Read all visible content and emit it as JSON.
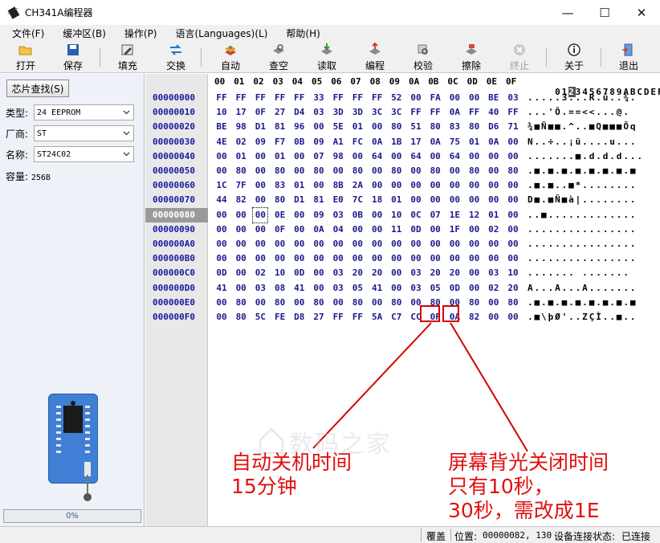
{
  "window": {
    "title": "CH341A编程器",
    "minimize": "—",
    "maximize": "☐",
    "close": "✕"
  },
  "menu": [
    "文件(F)",
    "缓冲区(B)",
    "操作(P)",
    "语言(Languages)(L)",
    "帮助(H)"
  ],
  "toolbar": {
    "open": "打开",
    "save": "保存",
    "fill": "填充",
    "swap": "交换",
    "auto": "自动",
    "blank": "查空",
    "read": "读取",
    "program": "编程",
    "verify": "校验",
    "erase": "擦除",
    "stop": "终止",
    "about": "关于",
    "exit": "退出"
  },
  "left": {
    "find_button": "芯片查找(S)",
    "type_label": "类型:",
    "type_value": "24 EEPROM",
    "maker_label": "厂商:",
    "maker_value": "ST",
    "name_label": "名称:",
    "name_value": "ST24C02",
    "capacity_label": "容量:",
    "capacity_value": "256B",
    "progress": "0%"
  },
  "hex": {
    "columns": [
      "00",
      "01",
      "02",
      "03",
      "04",
      "05",
      "06",
      "07",
      "08",
      "09",
      "0A",
      "0B",
      "0C",
      "0D",
      "0E",
      "0F"
    ],
    "ascii_header": "0123456789ABCDEF",
    "rows": [
      {
        "addr": "00000000",
        "bytes": [
          "FF",
          "FF",
          "FF",
          "FF",
          "FF",
          "33",
          "FF",
          "FF",
          "FF",
          "52",
          "00",
          "FA",
          "00",
          "00",
          "BE",
          "03"
        ],
        "ascii": ".....3...R.ú..¾."
      },
      {
        "addr": "00000010",
        "bytes": [
          "10",
          "17",
          "0F",
          "27",
          "D4",
          "03",
          "3D",
          "3D",
          "3C",
          "3C",
          "FF",
          "FF",
          "0A",
          "FF",
          "40",
          "FF"
        ],
        "ascii": "...'Ô.==<<...@."
      },
      {
        "addr": "00000020",
        "bytes": [
          "BE",
          "98",
          "D1",
          "81",
          "96",
          "00",
          "5E",
          "01",
          "00",
          "80",
          "51",
          "80",
          "83",
          "80",
          "D6",
          "71"
        ],
        "ascii": "¾■Ñ■■.^..■Q■■■Öq"
      },
      {
        "addr": "00000030",
        "bytes": [
          "4E",
          "02",
          "09",
          "F7",
          "0B",
          "09",
          "A1",
          "FC",
          "0A",
          "1B",
          "17",
          "0A",
          "75",
          "01",
          "0A",
          "00"
        ],
        "ascii": "N..÷..¡ü....u..."
      },
      {
        "addr": "00000040",
        "bytes": [
          "00",
          "01",
          "00",
          "01",
          "00",
          "07",
          "98",
          "00",
          "64",
          "00",
          "64",
          "00",
          "64",
          "00",
          "00",
          "00"
        ],
        "ascii": ".......■.d.d.d..."
      },
      {
        "addr": "00000050",
        "bytes": [
          "00",
          "80",
          "00",
          "80",
          "00",
          "80",
          "00",
          "80",
          "00",
          "80",
          "00",
          "80",
          "00",
          "80",
          "00",
          "80"
        ],
        "ascii": ".■.■.■.■.■.■.■.■"
      },
      {
        "addr": "00000060",
        "bytes": [
          "1C",
          "7F",
          "00",
          "83",
          "01",
          "00",
          "8B",
          "2A",
          "00",
          "00",
          "00",
          "00",
          "00",
          "00",
          "00",
          "00"
        ],
        "ascii": ".■.■..■*........"
      },
      {
        "addr": "00000070",
        "bytes": [
          "44",
          "82",
          "00",
          "80",
          "D1",
          "81",
          "E0",
          "7C",
          "18",
          "01",
          "00",
          "00",
          "00",
          "00",
          "00",
          "00"
        ],
        "ascii": "D■.■Ñ■à|........"
      },
      {
        "addr": "00000080",
        "bytes": [
          "00",
          "00",
          "00",
          "0E",
          "00",
          "09",
          "03",
          "0B",
          "00",
          "10",
          "0C",
          "07",
          "1E",
          "12",
          "01",
          "00"
        ],
        "ascii": "..■............."
      },
      {
        "addr": "00000090",
        "bytes": [
          "00",
          "00",
          "00",
          "0F",
          "00",
          "0A",
          "04",
          "00",
          "00",
          "11",
          "0D",
          "00",
          "1F",
          "00",
          "02",
          "00"
        ],
        "ascii": "................"
      },
      {
        "addr": "000000A0",
        "bytes": [
          "00",
          "00",
          "00",
          "00",
          "00",
          "00",
          "00",
          "00",
          "00",
          "00",
          "00",
          "00",
          "00",
          "00",
          "00",
          "00"
        ],
        "ascii": "................"
      },
      {
        "addr": "000000B0",
        "bytes": [
          "00",
          "00",
          "00",
          "00",
          "00",
          "00",
          "00",
          "00",
          "00",
          "00",
          "00",
          "00",
          "00",
          "00",
          "00",
          "00"
        ],
        "ascii": "................"
      },
      {
        "addr": "000000C0",
        "bytes": [
          "0D",
          "00",
          "02",
          "10",
          "0D",
          "00",
          "03",
          "20",
          "20",
          "00",
          "03",
          "20",
          "20",
          "00",
          "03",
          "10"
        ],
        "ascii": "....... ......."
      },
      {
        "addr": "000000D0",
        "bytes": [
          "41",
          "00",
          "03",
          "08",
          "41",
          "00",
          "03",
          "05",
          "41",
          "00",
          "03",
          "05",
          "0D",
          "00",
          "02",
          "20"
        ],
        "ascii": "A...A...A......."
      },
      {
        "addr": "000000E0",
        "bytes": [
          "00",
          "80",
          "00",
          "80",
          "00",
          "80",
          "00",
          "80",
          "00",
          "80",
          "00",
          "80",
          "00",
          "80",
          "00",
          "80"
        ],
        "ascii": ".■.■.■.■.■.■.■.■"
      },
      {
        "addr": "000000F0",
        "bytes": [
          "00",
          "80",
          "5C",
          "FE",
          "D8",
          "27",
          "FF",
          "FF",
          "5A",
          "C7",
          "CC",
          "0F",
          "0A",
          "82",
          "00",
          "00"
        ],
        "ascii": ".■\\þØ'..ZÇÌ..■.."
      }
    ]
  },
  "annotations": {
    "left_line1": "自动关机时间",
    "left_line2": "15分钟",
    "right_line1": "屏幕背光关闭时间",
    "right_line2": "只有10秒，",
    "right_line3": "30秒，需改成1E"
  },
  "watermark": "数码之家",
  "status": {
    "mode": "覆盖",
    "position_label": "位置:",
    "position_value": "00000082, 130",
    "conn_label": "设备连接状态:",
    "conn_value": "已连接"
  },
  "colors": {
    "hex_text": "#1a1a8c",
    "annotation": "#e01010",
    "selection": "#9a9a9a"
  }
}
